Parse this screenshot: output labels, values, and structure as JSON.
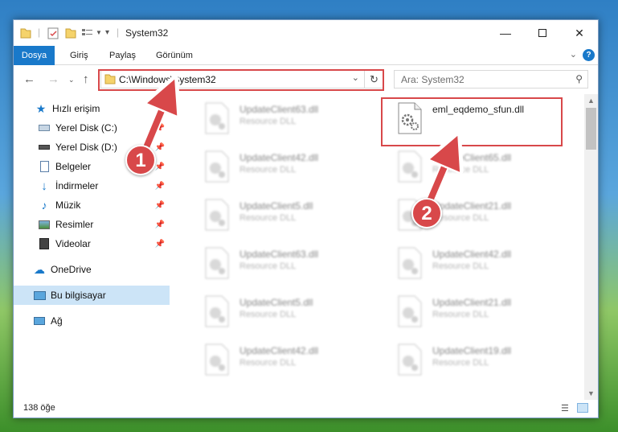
{
  "window": {
    "title": "System32",
    "ribbon_tabs": [
      "Dosya",
      "Giriş",
      "Paylaş",
      "Görünüm"
    ]
  },
  "address_bar": {
    "path": "C:\\Windows\\System32"
  },
  "search": {
    "placeholder": "Ara: System32"
  },
  "sidebar": {
    "quick_access_label": "Hızlı erişim",
    "items": [
      {
        "label": "Yerel Disk (C:)",
        "icon": "drive-icon",
        "pinned": true
      },
      {
        "label": "Yerel Disk (D:)",
        "icon": "drive-icon",
        "pinned": true
      },
      {
        "label": "Belgeler",
        "icon": "documents-icon",
        "pinned": true
      },
      {
        "label": "İndirmeler",
        "icon": "download-icon",
        "pinned": true
      },
      {
        "label": "Müzik",
        "icon": "music-icon",
        "pinned": true
      },
      {
        "label": "Resimler",
        "icon": "pictures-icon",
        "pinned": true
      },
      {
        "label": "Videolar",
        "icon": "videos-icon",
        "pinned": true
      }
    ],
    "onedrive_label": "OneDrive",
    "this_pc_label": "Bu bilgisayar",
    "network_label": "Ağ"
  },
  "files": {
    "highlighted": {
      "name": "eml_eqdemo_sfun.dll",
      "type": ""
    },
    "left_column": [
      {
        "name": "UpdateClient63.dll",
        "type": "Resource DLL"
      },
      {
        "name": "UpdateClient42.dll",
        "type": "Resource DLL"
      },
      {
        "name": "UpdateClient5.dll",
        "type": "Resource DLL"
      },
      {
        "name": "UpdateClient63.dll",
        "type": "Resource DLL"
      },
      {
        "name": "UpdateClient5.dll",
        "type": "Resource DLL"
      },
      {
        "name": "UpdateClient42.dll",
        "type": "Resource DLL"
      }
    ],
    "right_column": [
      {
        "name": "UpdateClient65.dll",
        "type": "Resource DLL"
      },
      {
        "name": "UpdateClient21.dll",
        "type": "Resource DLL"
      },
      {
        "name": "UpdateClient42.dll",
        "type": "Resource DLL"
      },
      {
        "name": "UpdateClient21.dll",
        "type": "Resource DLL"
      },
      {
        "name": "UpdateClient19.dll",
        "type": "Resource DLL"
      }
    ]
  },
  "status_bar": {
    "item_count": "138 öğe"
  },
  "annotations": {
    "marker_1": "1",
    "marker_2": "2"
  },
  "colors": {
    "accent": "#1979ca",
    "highlight_red": "#d8484a",
    "selection": "#cce4f7"
  }
}
